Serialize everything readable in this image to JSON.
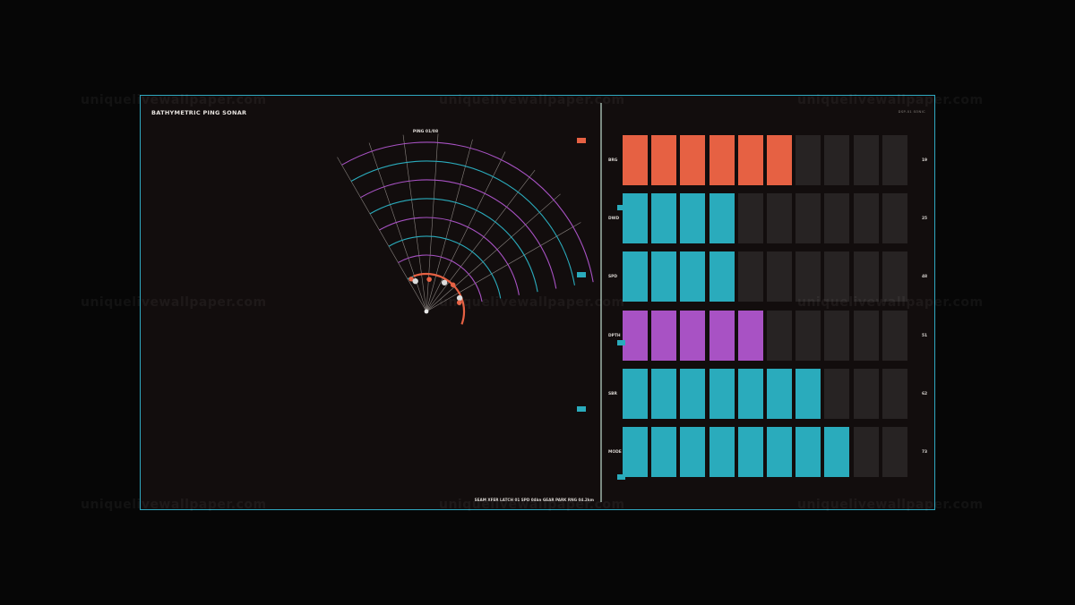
{
  "title": "BATHYMETRIC PING SONAR",
  "ping_label": "PING 01/08",
  "footer_status": "SEAM XFER  LATCH 01  SPD 04kn  GEAR PARK  RNG 04.2km",
  "corner_label": "DSP-01  SONIC",
  "watermark": "uniquelivewallpaper.com",
  "colors": {
    "accent_orange": "#e66143",
    "accent_cyan": "#2aabbc",
    "accent_purple": "#a852c4",
    "empty_cell": "#272323",
    "frame_border": "#2fa8c0"
  },
  "sonar": {
    "rings": 8,
    "ring_colors": [
      "cyan",
      "purple"
    ],
    "highlight_arc": "orange",
    "blips": [
      {
        "color": "orange"
      },
      {
        "color": "white"
      },
      {
        "color": "orange"
      },
      {
        "color": "white"
      },
      {
        "color": "orange"
      },
      {
        "color": "white"
      },
      {
        "color": "orange"
      }
    ]
  },
  "side_markers": [
    "orange",
    "cyan",
    "cyan"
  ],
  "levels": {
    "total_cells": 10,
    "rows": [
      {
        "label": "BRG",
        "value": "19",
        "filled": 6,
        "color": "orange"
      },
      {
        "label": "DWD",
        "value": "25",
        "filled": 4,
        "color": "cyan"
      },
      {
        "label": "SPD",
        "value": "48",
        "filled": 4,
        "color": "cyan"
      },
      {
        "label": "DPTH",
        "value": "51",
        "filled": 5,
        "color": "purple"
      },
      {
        "label": "SBR",
        "value": "62",
        "filled": 7,
        "color": "cyan"
      },
      {
        "label": "MODE",
        "value": "73",
        "filled": 8,
        "color": "cyan"
      }
    ]
  }
}
